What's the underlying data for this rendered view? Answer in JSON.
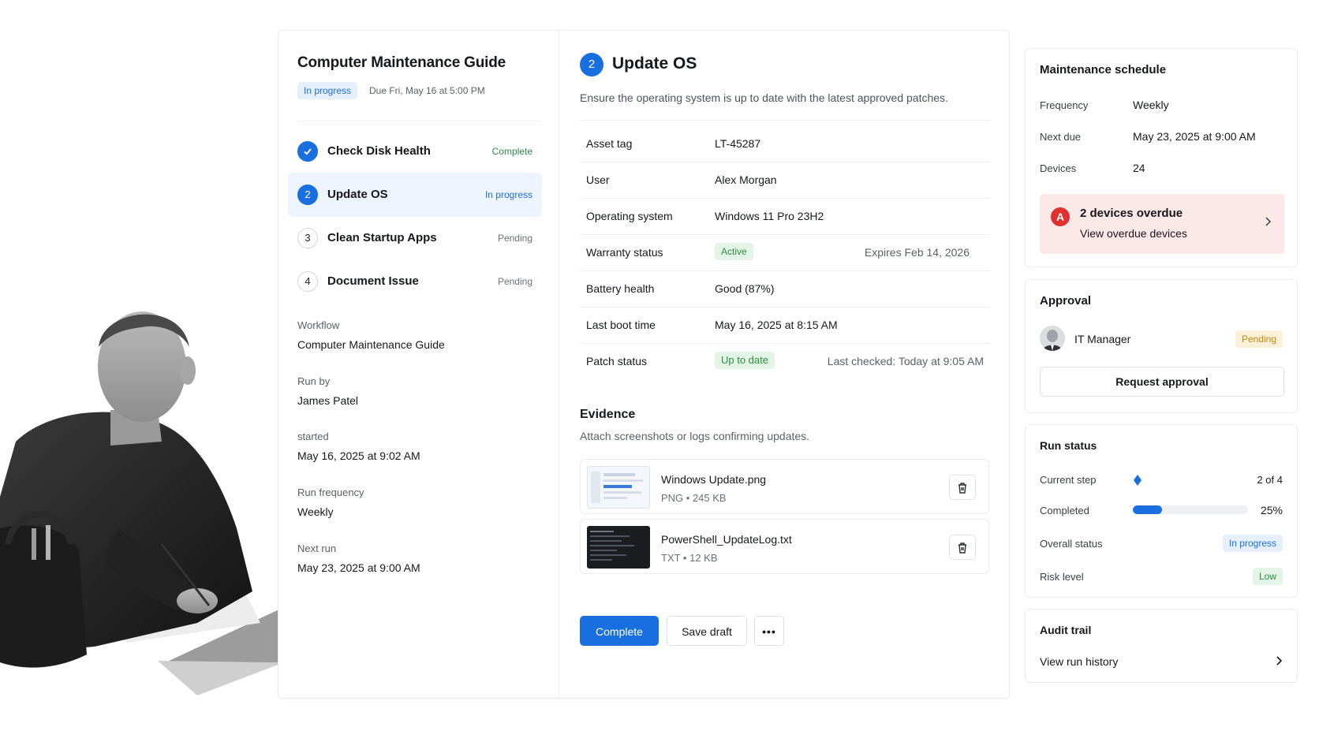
{
  "guide": {
    "title": "Computer Maintenance Guide",
    "status": "In progress",
    "due": "Due Fri, May 16 at 5:00 PM"
  },
  "steps": [
    {
      "num": "1",
      "label": "Check Disk Health",
      "status": "Complete"
    },
    {
      "num": "2",
      "label": "Update OS",
      "status": "In progress"
    },
    {
      "num": "3",
      "label": "Clean Startup Apps",
      "status": "Pending"
    },
    {
      "num": "4",
      "label": "Document Issue",
      "status": "Pending"
    }
  ],
  "meta": {
    "workflow_label": "Workflow",
    "workflow_value": "Computer Maintenance Guide",
    "runby_label": "Run by",
    "runby_value": "James Patel",
    "started_label": "started",
    "started_value": "May 16, 2025 at 9:02 AM",
    "frequency_label": "Run frequency",
    "frequency_value": "Weekly",
    "nextrun_label": "Next run",
    "nextrun_value": "May 23, 2025 at 9:00 AM"
  },
  "current_step": {
    "number": "2",
    "title": "Update OS",
    "description": "Ensure the operating system is up to date with the latest approved patches."
  },
  "details": {
    "asset_tag_label": "Asset tag",
    "asset_tag": "LT-45287",
    "user_label": "User",
    "user": "Alex Morgan",
    "os_label": "Operating system",
    "os": "Windows 11 Pro 23H2",
    "warranty_label": "Warranty status",
    "warranty_status": "Active",
    "warranty_expires": "Expires Feb 14, 2026",
    "battery_label": "Battery health",
    "battery": "Good (87%)",
    "boot_label": "Last boot time",
    "boot": "May 16, 2025 at 8:15 AM",
    "patch_label": "Patch status",
    "patch_status": "Up to date",
    "patch_checked": "Last checked: Today at 9:05 AM"
  },
  "evidence": {
    "title": "Evidence",
    "subtitle": "Attach screenshots or logs confirming updates.",
    "files": [
      {
        "name": "Windows Update.png",
        "meta": "PNG • 245 KB"
      },
      {
        "name": "PowerShell_UpdateLog.txt",
        "meta": "TXT • 12 KB"
      }
    ]
  },
  "actions": {
    "complete": "Complete",
    "save_draft": "Save draft",
    "more": "•••"
  },
  "schedule": {
    "title": "Maintenance schedule",
    "frequency_label": "Frequency",
    "frequency": "Weekly",
    "next_due_label": "Next due",
    "next_due": "May 23, 2025 at 9:00 AM",
    "devices_label": "Devices",
    "devices": "24",
    "alert_title": "2 devices overdue",
    "alert_link": "View overdue devices",
    "alert_icon": "A"
  },
  "approval": {
    "title": "Approval",
    "approver": "IT Manager",
    "status": "Pending",
    "request_button": "Request approval"
  },
  "run_status": {
    "title": "Run status",
    "current_step_label": "Current step",
    "current_step": "2 of 4",
    "completed_label": "Completed",
    "completed": "25%",
    "completed_fraction": 0.25,
    "overall_label": "Overall status",
    "overall": "In progress",
    "risk_label": "Risk level",
    "risk": "Low"
  },
  "audit": {
    "title": "Audit trail",
    "link": "View run history"
  },
  "colors": {
    "accent": "#1a6fe0",
    "success": "#2f8a45",
    "warning": "#c8860c",
    "danger": "#e0312f"
  }
}
